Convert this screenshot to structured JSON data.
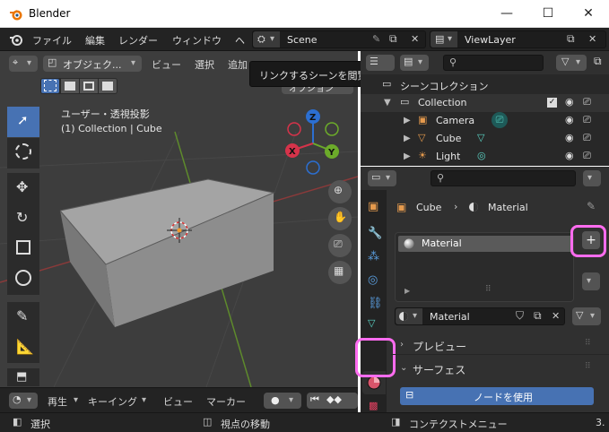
{
  "window": {
    "title": "Blender",
    "minimize": "—",
    "maximize": "☐",
    "close": "✕"
  },
  "menubar": {
    "items": [
      "ファイル",
      "編集",
      "レンダー",
      "ウィンドウ",
      "ヘ"
    ],
    "scene": "Scene",
    "view_layer": "ViewLayer"
  },
  "viewport": {
    "mode": "オブジェク...",
    "menus": [
      "ビュー",
      "選択",
      "追加"
    ],
    "view_name": "ユーザー・透視投影",
    "object_info": "(1) Collection | Cube",
    "options": "オプション",
    "gizmo": {
      "z": "Z",
      "y": "Y",
      "x": "X"
    }
  },
  "tooltip": {
    "text": "リンクするシーンを閲覧."
  },
  "timeline": {
    "playback": "再生",
    "keying": "キーイング",
    "view": "ビュー",
    "marker": "マーカー"
  },
  "outliner": {
    "root": "シーンコレクション",
    "collection": "Collection",
    "items": [
      "Camera",
      "Cube",
      "Light"
    ]
  },
  "properties": {
    "breadcrumb_object": "Cube",
    "breadcrumb_material": "Material",
    "slot": "Material",
    "material_name": "Material",
    "preview": "プレビュー",
    "surface": "サーフェス",
    "use_nodes": "ノードを使用",
    "add_slot": "+"
  },
  "statusbar": {
    "select": "選択",
    "move_view": "視点の移動",
    "context_menu": "コンテクストメニュー",
    "version": "3."
  }
}
